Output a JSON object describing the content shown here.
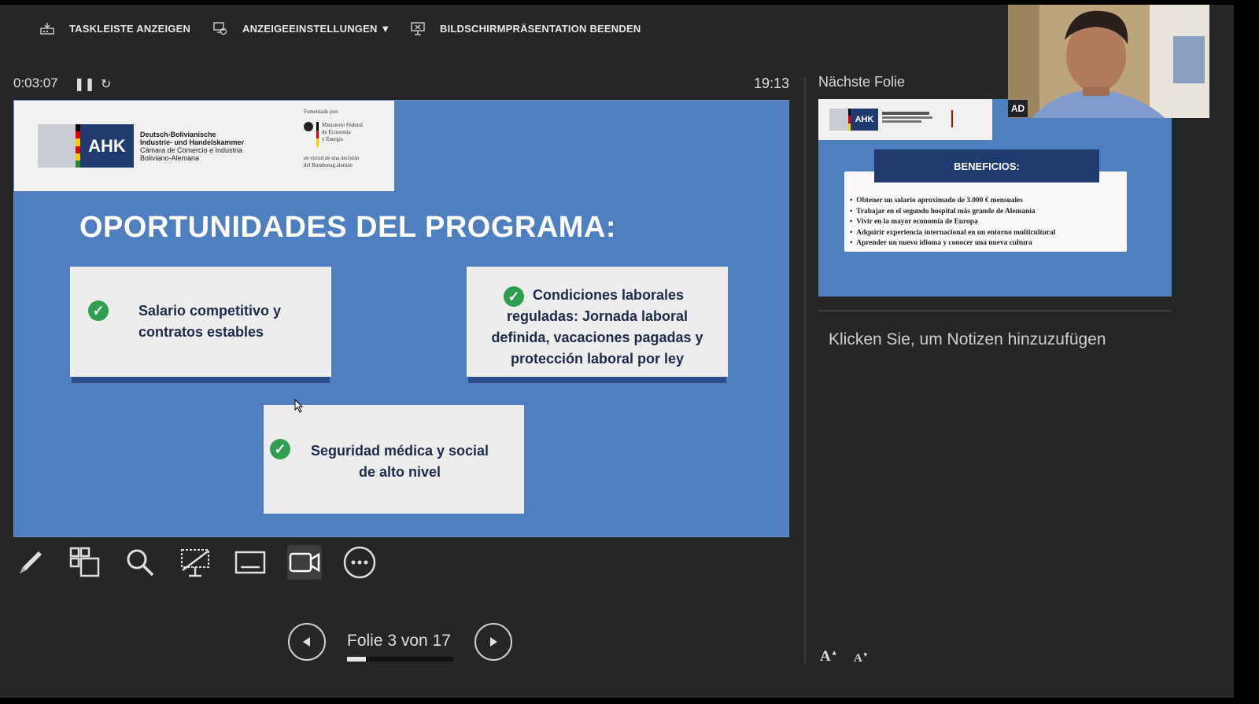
{
  "toolbar": {
    "show_taskbar": "TASKLEISTE ANZEIGEN",
    "display_settings": "ANZEIGEEINSTELLUNGEN ▼",
    "end_slideshow": "BILDSCHIRMPRÄSENTATION BEENDEN"
  },
  "timer": "0:03:07",
  "clock": "19:13",
  "next_slide_label": "Nächste Folie",
  "current_slide": {
    "header": {
      "logo_text": "AHK",
      "org_lines": [
        "Deutsch-Bolivianische",
        "Industrie- und Handelskammer",
        "Cámara de Comercio e Industria",
        "Boliviano-Alemana"
      ],
      "sponsor_label": "Fomentado por:",
      "ministry_lines": [
        "Ministerio Federal",
        "de Economía",
        "y Energía"
      ],
      "decision_lines": [
        "en virtud de una decisión",
        "del Bundestag alemán"
      ]
    },
    "title": "OPORTUNIDADES DEL PROGRAMA:",
    "cards": [
      "Salario competitivo y contratos estables",
      "Condiciones laborales reguladas: Jornada laboral definida, vacaciones pagadas y protección laboral por ley",
      "Seguridad médica y social de alto nivel"
    ]
  },
  "navigation": {
    "slide_indicator": "Folie 3 von 17",
    "progress": 0.176
  },
  "next_slide": {
    "logo_text": "AHK",
    "title": "BENEFICIOS:",
    "bullets": [
      "Obtener un salario aproximado de 3.000 € mensuales",
      "Trabajar en el segundo hospital más grande de Alemania",
      "Vivir en la mayor economía de Europa",
      "Adquirir experiencia internacional en un entorno multicultural",
      "Aprender un nuevo idioma y conocer una nueva cultura"
    ]
  },
  "notes_placeholder": "Klicken Sie, um Notizen hinzuzufügen",
  "webcam": {
    "badge": "AD"
  },
  "font_size": {
    "increase": "A",
    "decrease": "A"
  },
  "colors": {
    "slide_blue": "#4f7fc1",
    "navy": "#1f3a6e",
    "check_green": "#2e9e4f",
    "background": "#262626"
  }
}
